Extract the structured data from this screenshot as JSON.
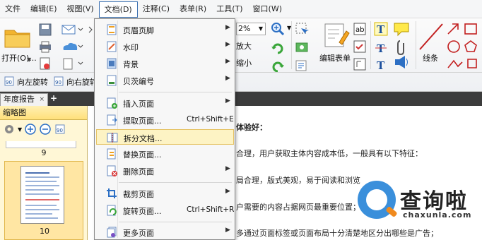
{
  "menubar": {
    "items": [
      {
        "label": "文件"
      },
      {
        "label": "编辑(E)"
      },
      {
        "label": "视图(V)"
      },
      {
        "label": "文档(D)"
      },
      {
        "label": "注释(C)"
      },
      {
        "label": "表单(R)"
      },
      {
        "label": "工具(T)"
      },
      {
        "label": "窗口(W)"
      }
    ],
    "active_index": 3
  },
  "ribbon": {
    "open_label": "打开(O)...",
    "zoom_value": "2%",
    "zoom_in_label": "放大",
    "zoom_out_label": "缩小",
    "edit_form_label": "编辑表单",
    "lines_label": "线条",
    "rotate_left_label": "向左旋转",
    "rotate_right_label": "向右旋转"
  },
  "tabs": {
    "doc_tab": "年度报告",
    "add_symbol": "+",
    "close_symbol": "×"
  },
  "left_panel": {
    "title": "缩略图",
    "page_above": "9",
    "page_selected": "10"
  },
  "content": {
    "lines": [
      "体验好：",
      "合理，用户获取主体内容成本低，一般具有以下特征：",
      "局合理，版式美观，易于阅读和浏览",
      "户需要的内容占据网页最重要位置；",
      "多通过页面标签或页面布局十分清楚地区分出哪些是广告；"
    ]
  },
  "watermark": {
    "brand": "查询啦",
    "url": "chaxunla.com"
  },
  "dropdown": {
    "items": [
      {
        "label": "页眉页脚",
        "shortcut": "",
        "submenu": true,
        "icon": "header-footer-icon"
      },
      {
        "label": "水印",
        "shortcut": "",
        "submenu": true,
        "icon": "watermark-icon"
      },
      {
        "label": "背景",
        "shortcut": "",
        "submenu": true,
        "icon": "background-icon"
      },
      {
        "label": "贝茨编号",
        "shortcut": "",
        "submenu": true,
        "icon": "bates-number-icon"
      },
      {
        "label": "插入页面",
        "shortcut": "",
        "submenu": true,
        "icon": "insert-page-icon"
      },
      {
        "label": "提取页面...",
        "shortcut": "Ctrl+Shift+E",
        "submenu": false,
        "icon": "extract-page-icon"
      },
      {
        "label": "拆分文档...",
        "shortcut": "",
        "submenu": false,
        "icon": "split-document-icon"
      },
      {
        "label": "替换页面...",
        "shortcut": "",
        "submenu": false,
        "icon": "replace-page-icon"
      },
      {
        "label": "删除页面",
        "shortcut": "",
        "submenu": true,
        "icon": "delete-page-icon"
      },
      {
        "label": "裁剪页面",
        "shortcut": "",
        "submenu": true,
        "icon": "crop-page-icon"
      },
      {
        "label": "旋转页面...",
        "shortcut": "Ctrl+Shift+R",
        "submenu": false,
        "icon": "rotate-page-icon"
      },
      {
        "label": "更多页面",
        "shortcut": "",
        "submenu": true,
        "icon": "more-pages-icon"
      }
    ],
    "highlighted_index": 6,
    "submenu_arrow": "▶"
  }
}
